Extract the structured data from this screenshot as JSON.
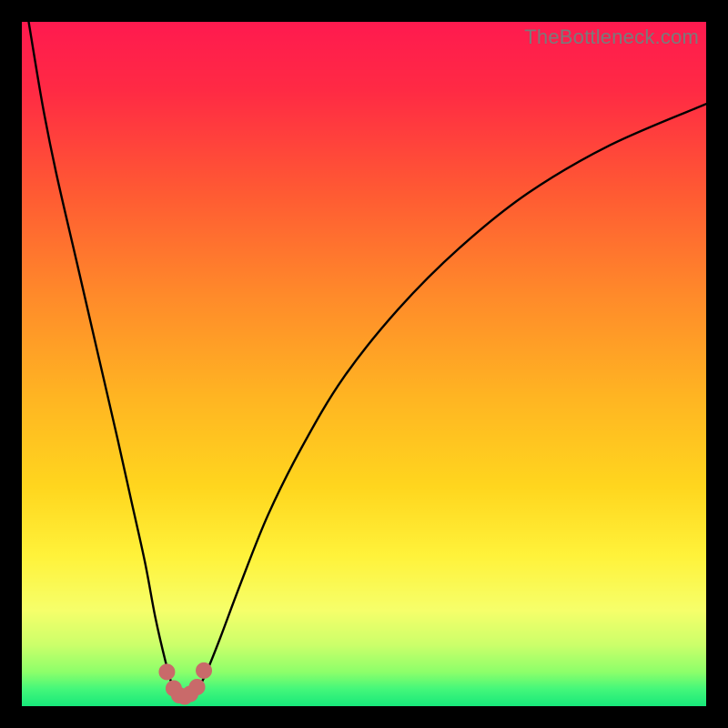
{
  "watermark": "TheBottleneck.com",
  "colors": {
    "gradient_stops": [
      {
        "offset": 0.0,
        "color": "#ff1a4f"
      },
      {
        "offset": 0.1,
        "color": "#ff2a44"
      },
      {
        "offset": 0.25,
        "color": "#ff5a33"
      },
      {
        "offset": 0.4,
        "color": "#ff8a2a"
      },
      {
        "offset": 0.55,
        "color": "#ffb522"
      },
      {
        "offset": 0.68,
        "color": "#ffd61e"
      },
      {
        "offset": 0.78,
        "color": "#fff23a"
      },
      {
        "offset": 0.86,
        "color": "#f6ff6a"
      },
      {
        "offset": 0.91,
        "color": "#ccff6a"
      },
      {
        "offset": 0.95,
        "color": "#8dff6a"
      },
      {
        "offset": 0.975,
        "color": "#44f77a"
      },
      {
        "offset": 1.0,
        "color": "#17e87a"
      }
    ],
    "curve": "#000000",
    "marker_fill": "#c96a6a",
    "marker_stroke": "#c96a6a"
  },
  "chart_data": {
    "type": "line",
    "title": "",
    "xlabel": "",
    "ylabel": "",
    "xlim": [
      0,
      100
    ],
    "ylim": [
      0,
      100
    ],
    "series": [
      {
        "name": "bottleneck-curve",
        "x": [
          1,
          3,
          5,
          8,
          11,
          14,
          16,
          18,
          19.5,
          21,
          22,
          23,
          24,
          25,
          26,
          27,
          29,
          32,
          36,
          41,
          47,
          55,
          64,
          74,
          86,
          100
        ],
        "y": [
          100,
          88,
          78,
          65,
          52,
          39,
          30,
          21,
          13,
          6.5,
          3,
          1.5,
          1,
          1.5,
          3,
          5,
          10,
          18,
          28,
          38,
          48,
          58,
          67,
          75,
          82,
          88
        ]
      }
    ],
    "markers": {
      "name": "dip-markers",
      "x": [
        21.2,
        22.2,
        23.0,
        23.8,
        24.6,
        25.6,
        26.6
      ],
      "y": [
        5.0,
        2.6,
        1.6,
        1.4,
        1.8,
        2.8,
        5.2
      ]
    }
  }
}
